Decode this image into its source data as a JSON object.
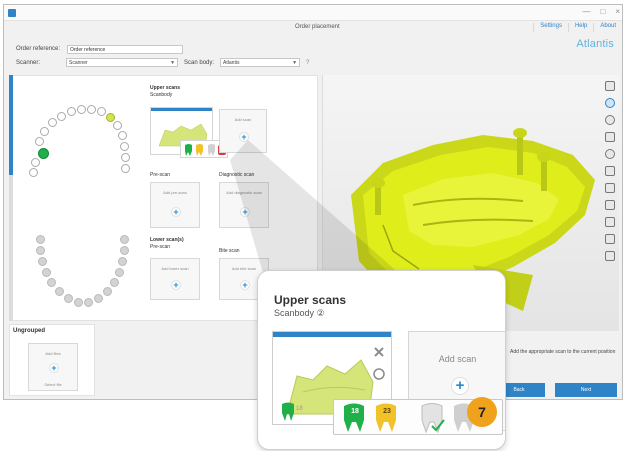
{
  "app": {
    "title": "Order placement",
    "brand": "Atlantis",
    "top_links": [
      "Settings",
      "Help",
      "About"
    ],
    "window_controls": [
      "—",
      "□",
      "×"
    ]
  },
  "order": {
    "reference_label": "Order reference:",
    "reference_value": "Order reference",
    "scanner_label": "Scanner:",
    "scanner_value": "Scanner",
    "scan_body_label": "Scan body:",
    "scan_body_value": "Atlantis",
    "help_icon": "?"
  },
  "upper_jaw": {
    "title": "Upper scans",
    "subtitle": "Scanbody",
    "add_scan_label": "Add scan",
    "sections": [
      {
        "title": "Pre-scan",
        "add_label": "Add pre-scan"
      },
      {
        "title": "Diagnostic scan",
        "add_label": "Add diagnostic scan"
      }
    ]
  },
  "lower_jaw": {
    "title": "Lower scan(s)",
    "subtitle": "Pre-scan",
    "add_label": "Add lower scan",
    "bite_title": "Bite scan",
    "bite_add_label": "Add bite scan"
  },
  "ungrouped": {
    "title": "Ungrouped",
    "card_label": "Add files",
    "card_sub": "Select file"
  },
  "status": {
    "info_text": "Add the appropriate scan to the current position"
  },
  "buttons": {
    "back": "Back",
    "next": "Next"
  },
  "callout": {
    "title": "Upper scans",
    "subtitle": "Scanbody",
    "subtitle_mark": "②",
    "add_scan": "Add scan",
    "tooth_1": "18",
    "tooth_2": "23",
    "small_tooth": "18",
    "step_badge": "7"
  },
  "colors": {
    "accent_blue": "#2f84c8",
    "model_yellow": "#dfee1b",
    "tooth_green": "#1fb04a",
    "tooth_yellow": "#f2c22b",
    "badge_orange": "#f0a21d"
  }
}
